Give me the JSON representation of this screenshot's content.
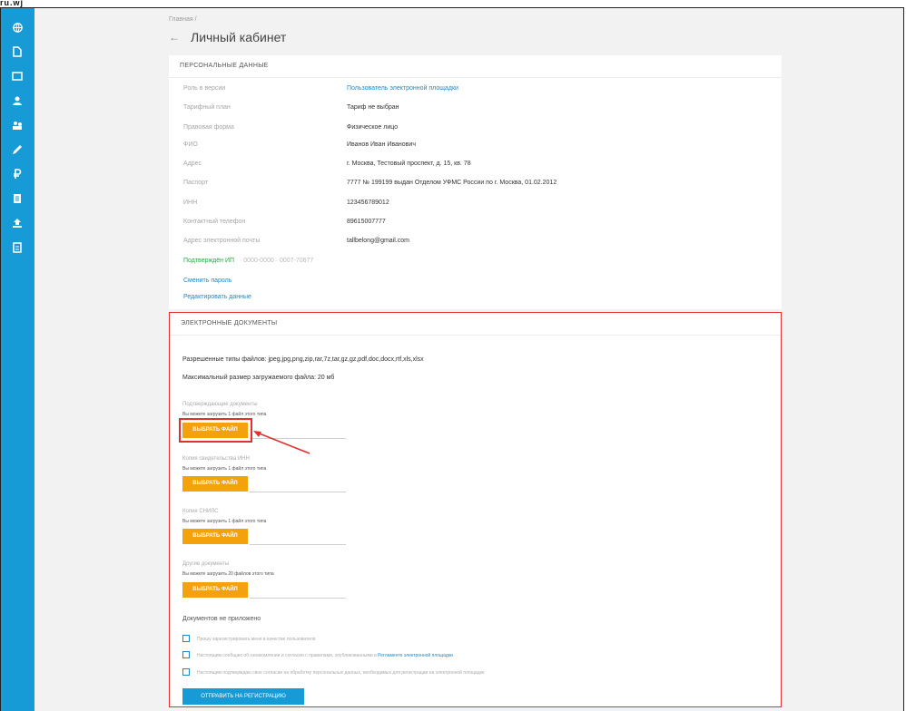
{
  "top_mark": "ru.wj",
  "breadcrumb": "Главная /",
  "page_title": "Личный кабинет",
  "personal": {
    "header": "Персональные данные",
    "rows": [
      {
        "label": "Роль в версии",
        "value": "Пользователь электронной площадки",
        "link": true
      },
      {
        "label": "Тарифный план",
        "value": "Тариф не выбран"
      },
      {
        "label": "Правовая форма",
        "value": "Физическое лицо"
      },
      {
        "label": "ФИО",
        "value": "Иванов Иван Иванович"
      },
      {
        "label": "Адрес",
        "value": "г. Москва, Тестовый проспект, д. 15, кв. 78"
      },
      {
        "label": "Паспорт",
        "value": "7777 № 199199 выдан Отделом УФМС России по г. Москва, 01.02.2012"
      },
      {
        "label": "ИНН",
        "value": "123456789012"
      },
      {
        "label": "Контактный телефон",
        "value": "89615007777"
      },
      {
        "label": "Адрес электронной почты",
        "value": "tallbelong@gmail.com"
      }
    ],
    "password_label": "Подтверждён ИП",
    "password_mask": "·  0000-0000  ·  0007-70677",
    "change_password": "Сменить пароль",
    "edit_data": "Редактировать данные"
  },
  "docs": {
    "header": "Электронные документы",
    "allowed_types": "Разрешенные типы файлов: jpeg,jpg,png,zip,rar,7z,tar,gz,gz,pdf,doc,docx,rtf,xls,xlsx",
    "max_size": "Максимальный размер загружаемого файла: 20 мб",
    "uploads": [
      {
        "label": "Подтверждающие документы",
        "hint": "Вы можете загрузить 1 файл этого типа",
        "button": "Выбрать файл"
      },
      {
        "label": "Копия свидетельства ИНН",
        "hint": "Вы можете загрузить 1 файл этого типа",
        "button": "Выбрать файл"
      },
      {
        "label": "Копия СНИЛС",
        "hint": "Вы можете загрузить 1 файл этого типа",
        "button": "Выбрать файл"
      },
      {
        "label": "Другие документы",
        "hint": "Вы можете загрузить 20 файлов этого типа",
        "button": "Выбрать файл"
      }
    ],
    "agree_title": "Документов не приложено",
    "checkboxes": [
      {
        "text": "Прошу зарегистрировать меня в качестве пользователя",
        "link": ""
      },
      {
        "text": "Настоящим сообщаю об ознакомлении и согласии с правилами, опубликованными в ",
        "link": "Регламенте электронной площадки"
      },
      {
        "text": "Настоящим подтверждаю свое согласие на обработку персональных данных, необходимых для регистрации на электронной площадке",
        "link": ""
      }
    ],
    "submit": "Отправить на регистрацию"
  },
  "colors": {
    "sidebar": "#169bd7",
    "upload_button": "#f4a20c",
    "submit_button": "#169bd7",
    "highlight": "#e03030",
    "link": "#1e88c8"
  },
  "sidebar_icons": [
    "globe-icon",
    "document-icon",
    "id-card-icon",
    "people-icon",
    "handshake-icon",
    "signature-icon",
    "ruble-icon",
    "list-icon",
    "upload-icon",
    "report-icon"
  ]
}
